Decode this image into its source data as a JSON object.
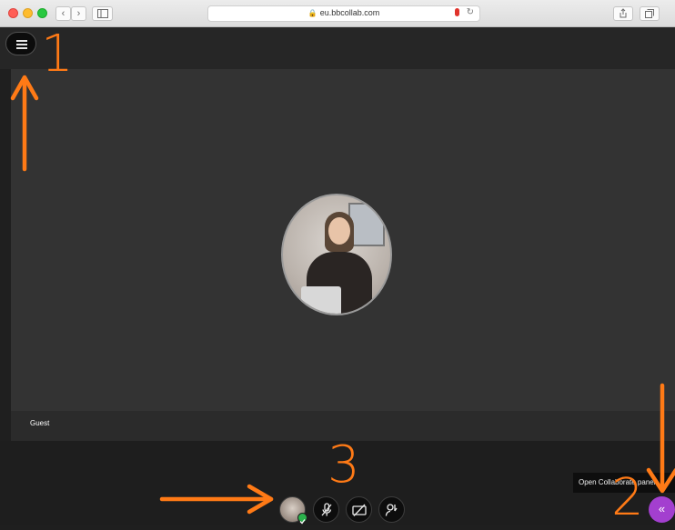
{
  "browser": {
    "url": "eu.bbcollab.com",
    "back_glyph": "‹",
    "forward_glyph": "›",
    "reload_glyph": "↻",
    "lock_glyph": "🔒"
  },
  "session": {
    "participant_name": "Guest"
  },
  "panel": {
    "tooltip": "Open Collaborate panel",
    "button_glyph": "«"
  },
  "annotations": {
    "label_1": "1",
    "label_2": "2",
    "label_3": "3",
    "color": "#ff7a16"
  },
  "colors": {
    "panel_button": "#a33fcf",
    "status_online": "#2bb24c"
  },
  "icons": [
    "menu-icon",
    "microphone-muted-icon",
    "camera-off-icon",
    "hand-raise-icon",
    "chevron-double-left-icon",
    "lock-icon",
    "reload-icon",
    "share-icon",
    "tabs-icon",
    "sidebar-icon"
  ]
}
